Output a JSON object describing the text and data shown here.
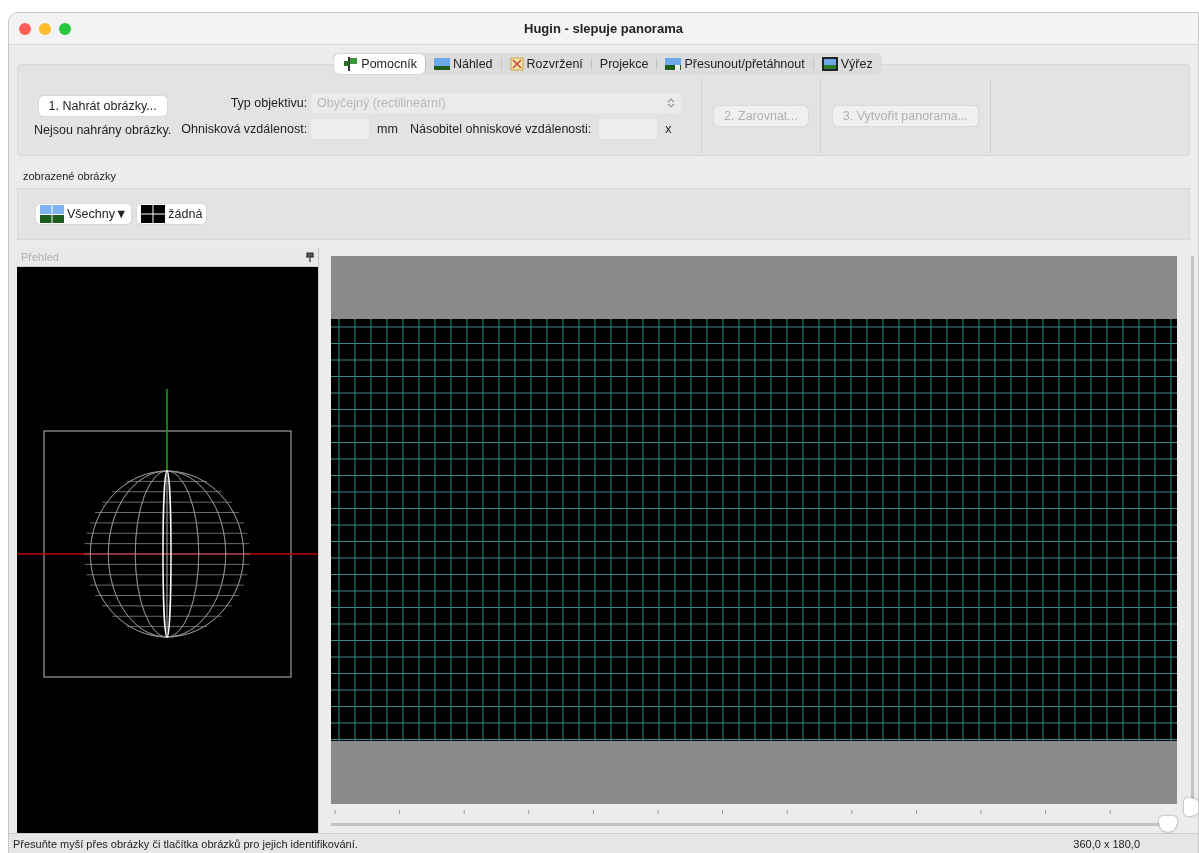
{
  "window": {
    "title": "Hugin - slepuje panorama"
  },
  "tabs": [
    {
      "label": "Pomocník",
      "selected": true
    },
    {
      "label": "Náhled",
      "selected": false
    },
    {
      "label": "Rozvržení",
      "selected": false
    },
    {
      "label": "Projekce",
      "selected": false
    },
    {
      "label": "Přesunout/přetáhnout",
      "selected": false
    },
    {
      "label": "Výřez",
      "selected": false
    }
  ],
  "assistant": {
    "load_button": {
      "label": "1. Nahrát obrázky...",
      "disabled": false
    },
    "status": "Nejsou nahrány obrázky.",
    "lens_type": {
      "label": "Typ objektivu:",
      "value": "Obyčejný (rectilineární)",
      "disabled": true
    },
    "focal_length": {
      "label": "Ohnisková vzdálenost:",
      "unit": "mm"
    },
    "crop_factor": {
      "label": "Násobitel ohniskové vzdálenosti:",
      "unit": "x"
    },
    "align_button": {
      "label": "2. Zarovnat...",
      "disabled": true
    },
    "create_button": {
      "label": "3. Vytvořit panorama...",
      "disabled": true
    }
  },
  "displayed_images": {
    "label": "zobrazené obrázky",
    "buttons": [
      {
        "label": "Všechny▼"
      },
      {
        "label": "žádná"
      }
    ]
  },
  "overview": {
    "title": "Přehled"
  },
  "preview": {
    "h_slider": {
      "level": 1
    },
    "v_slider": {
      "level": 0
    }
  },
  "status_bar": {
    "message": "Přesuňte myší přes obrázky či tlačítka obrázků pro jejich identifikování.",
    "size": "360,0 x 180,0"
  }
}
